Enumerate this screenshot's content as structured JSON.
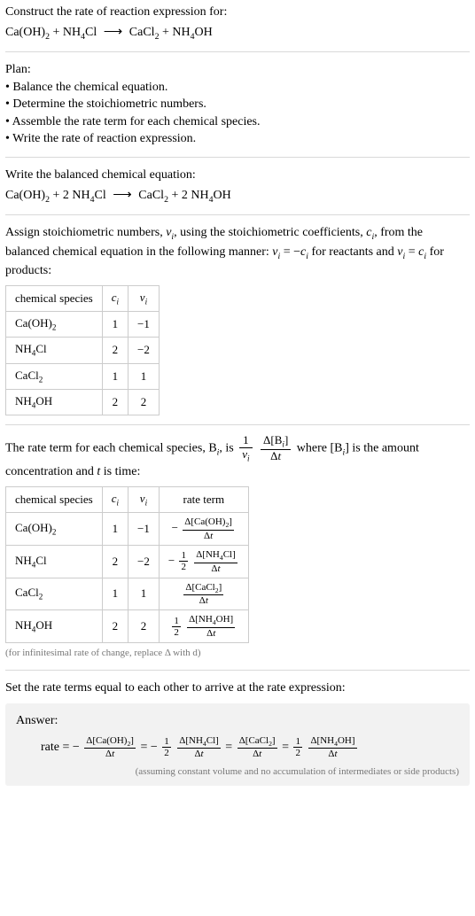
{
  "title": "Construct the rate of reaction expression for:",
  "unbalanced_eq_html": "Ca(OH)<span class='sub'>2</span> + NH<span class='sub'>4</span>Cl <span class='arrow'>⟶</span> CaCl<span class='sub'>2</span> + NH<span class='sub'>4</span>OH",
  "plan_header": "Plan:",
  "plan": [
    "• Balance the chemical equation.",
    "• Determine the stoichiometric numbers.",
    "• Assemble the rate term for each chemical species.",
    "• Write the rate of reaction expression."
  ],
  "balanced_intro": "Write the balanced chemical equation:",
  "balanced_eq_html": "Ca(OH)<span class='sub'>2</span> + 2 NH<span class='sub'>4</span>Cl <span class='arrow'>⟶</span> CaCl<span class='sub'>2</span> + 2 NH<span class='sub'>4</span>OH",
  "stoich_intro_html": "Assign stoichiometric numbers, <span class='it'>ν<span class='sub'>i</span></span>, using the stoichiometric coefficients, <span class='it'>c<span class='sub'>i</span></span>, from the balanced chemical equation in the following manner: <span class='it'>ν<span class='sub'>i</span></span> = −<span class='it'>c<span class='sub'>i</span></span> for reactants and <span class='it'>ν<span class='sub'>i</span></span> = <span class='it'>c<span class='sub'>i</span></span> for products:",
  "table1": {
    "headers_html": [
      "chemical species",
      "<span class='it'>c<span class='sub'>i</span></span>",
      "<span class='it'>ν<span class='sub'>i</span></span>"
    ],
    "rows": [
      {
        "sp": "Ca(OH)<span class='sub'>2</span>",
        "c": "1",
        "v": "−1"
      },
      {
        "sp": "NH<span class='sub'>4</span>Cl",
        "c": "2",
        "v": "−2"
      },
      {
        "sp": "CaCl<span class='sub'>2</span>",
        "c": "1",
        "v": "1"
      },
      {
        "sp": "NH<span class='sub'>4</span>OH",
        "c": "2",
        "v": "2"
      }
    ]
  },
  "rateterm_intro_pre": "The rate term for each chemical species, B",
  "rateterm_intro_mid1": ", is ",
  "rateterm_intro_mid2": " where [B",
  "rateterm_intro_post": "] is the amount concentration and ",
  "rateterm_intro_tail": " is time:",
  "table2": {
    "headers_html": [
      "chemical species",
      "<span class='it'>c<span class='sub'>i</span></span>",
      "<span class='it'>ν<span class='sub'>i</span></span>",
      "rate term"
    ],
    "rows": [
      {
        "sp": "Ca(OH)<span class='sub'>2</span>",
        "c": "1",
        "v": "−1",
        "rt": "− <span class='frac'><span class='num'>Δ[Ca(OH)<span class='sub'>2</span>]</span><span class='den'>Δ<span class='it'>t</span></span></span>"
      },
      {
        "sp": "NH<span class='sub'>4</span>Cl",
        "c": "2",
        "v": "−2",
        "rt": "− <span class='frac'><span class='num'>1</span><span class='den'>2</span></span> <span class='frac'><span class='num'>Δ[NH<span class='sub'>4</span>Cl]</span><span class='den'>Δ<span class='it'>t</span></span></span>"
      },
      {
        "sp": "CaCl<span class='sub'>2</span>",
        "c": "1",
        "v": "1",
        "rt": "<span class='frac'><span class='num'>Δ[CaCl<span class='sub'>2</span>]</span><span class='den'>Δ<span class='it'>t</span></span></span>"
      },
      {
        "sp": "NH<span class='sub'>4</span>OH",
        "c": "2",
        "v": "2",
        "rt": "<span class='frac'><span class='num'>1</span><span class='den'>2</span></span> <span class='frac'><span class='num'>Δ[NH<span class='sub'>4</span>OH]</span><span class='den'>Δ<span class='it'>t</span></span></span>"
      }
    ]
  },
  "note_infinitesimal": "(for infinitesimal rate of change, replace Δ with d)",
  "set_equal": "Set the rate terms equal to each other to arrive at the rate expression:",
  "answer_label": "Answer:",
  "answer_eq_html": "rate = − <span class='frac'><span class='num'>Δ[Ca(OH)<span class='sub'>2</span>]</span><span class='den'>Δ<span class='it'>t</span></span></span> = − <span class='frac'><span class='num'>1</span><span class='den'>2</span></span> <span class='frac'><span class='num'>Δ[NH<span class='sub'>4</span>Cl]</span><span class='den'>Δ<span class='it'>t</span></span></span> = <span class='frac'><span class='num'>Δ[CaCl<span class='sub'>2</span>]</span><span class='den'>Δ<span class='it'>t</span></span></span> = <span class='frac'><span class='num'>1</span><span class='den'>2</span></span> <span class='frac'><span class='num'>Δ[NH<span class='sub'>4</span>OH]</span><span class='den'>Δ<span class='it'>t</span></span></span>",
  "answer_note": "(assuming constant volume and no accumulation of intermediates or side products)",
  "t_var": "t",
  "i_sub": "i"
}
